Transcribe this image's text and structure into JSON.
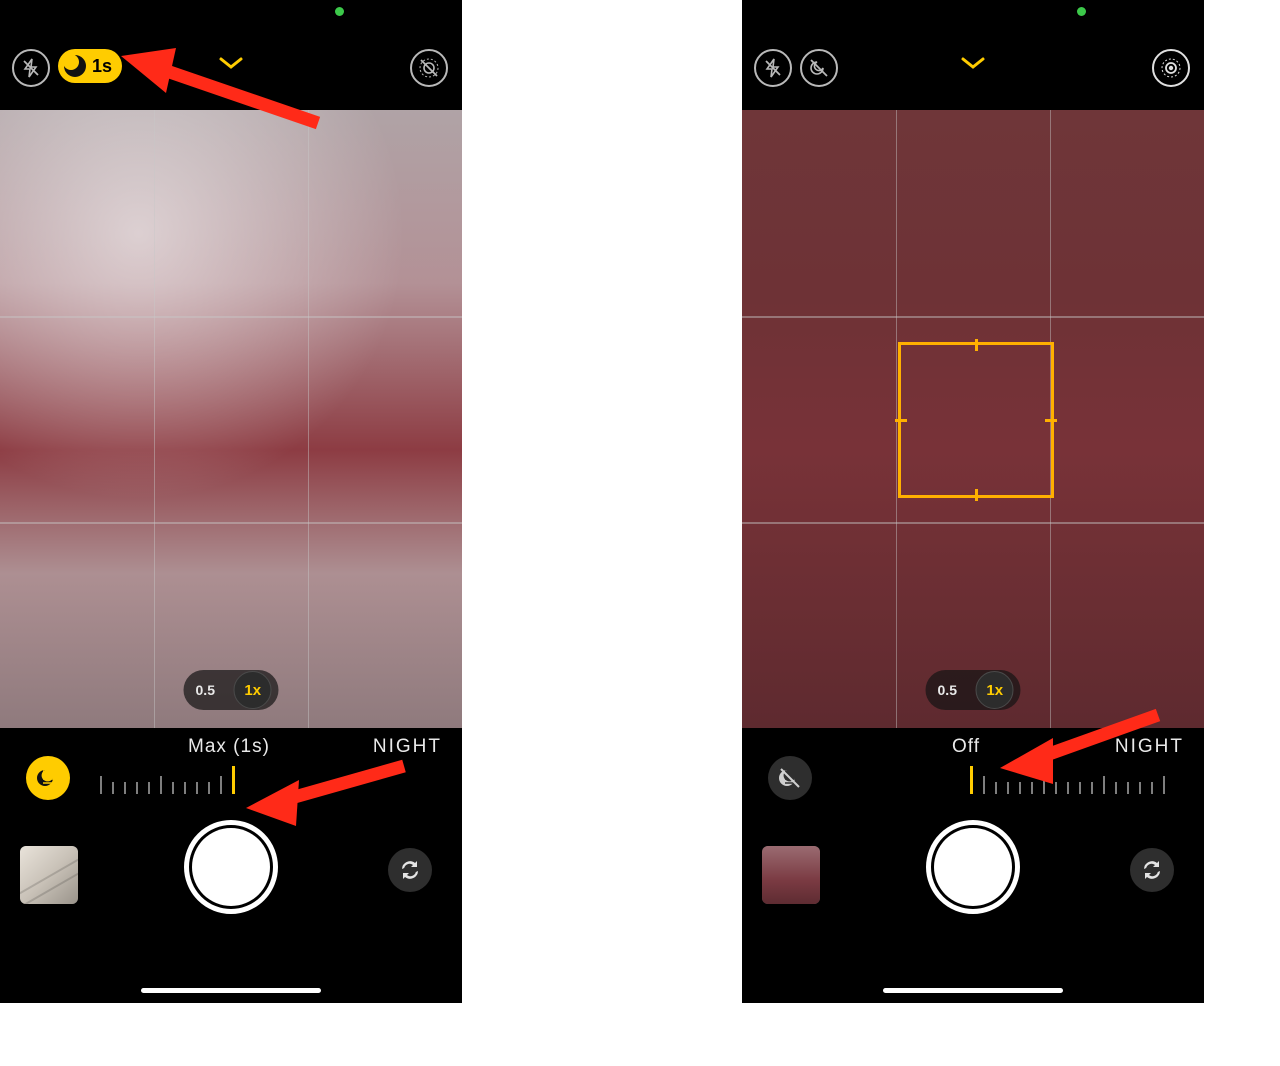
{
  "left": {
    "nightpill_label": "1s",
    "zoom": {
      "wide": "0.5",
      "main": "1x"
    },
    "slider_label": "Max (1s)",
    "mode_label": "NIGHT",
    "night_toggle_on": true
  },
  "right": {
    "zoom": {
      "wide": "0.5",
      "main": "1x"
    },
    "slider_label": "Off",
    "mode_label": "NIGHT",
    "night_toggle_on": false
  },
  "colors": {
    "accent": "#ffcc00",
    "arrow": "#ff2a18"
  }
}
